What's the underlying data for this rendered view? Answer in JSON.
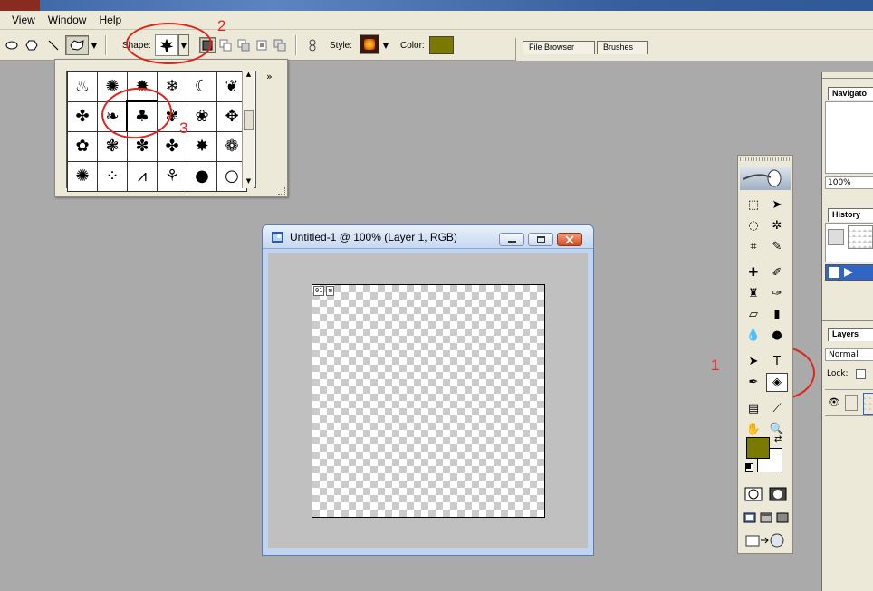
{
  "menu": [
    "View",
    "Window",
    "Help"
  ],
  "options_bar": {
    "shape_label": "Shape:",
    "style_label": "Style:",
    "color_label": "Color:",
    "color": "#7a7a00",
    "shape_icon": "maple-leaf-icon"
  },
  "palette_well": {
    "tabs": [
      "File Browser",
      "Brushes"
    ]
  },
  "shape_picker": {
    "rows": [
      [
        "flame-icon",
        "starburst-icon",
        "splat-icon",
        "snowflake-icon",
        "moon-icon",
        "leaf-icon"
      ],
      [
        "maple-leaf-icon",
        "fleur-icon",
        "leaf-shape-icon",
        "tree-icon",
        "oak-leaf-icon",
        "maple-small-icon"
      ],
      [
        "flower-icon",
        "blossom-icon",
        "sprig-icon",
        "clover-icon",
        "sun-flower-icon",
        "daisy-icon"
      ],
      [
        "sunflower-icon",
        "dots-icon",
        "grass-icon",
        "grass-tall-icon",
        "bulb-icon",
        "bulb-outline-icon"
      ]
    ],
    "selected": [
      1,
      2
    ],
    "expand_label": "»"
  },
  "annotations": {
    "one": "1",
    "two": "2",
    "three": "3",
    "color": "#e2231a"
  },
  "document": {
    "title": "Untitled-1 @ 100% (Layer 1, RGB)",
    "slice_badge": "01"
  },
  "toolbox": {
    "foreground": "#7a7a00",
    "background": "#ffffff"
  },
  "panels": {
    "navigator": "Navigato",
    "zoom": "100%",
    "history": "History",
    "layers": "Layers",
    "blend_mode": "Normal",
    "lock_label": "Lock:"
  }
}
